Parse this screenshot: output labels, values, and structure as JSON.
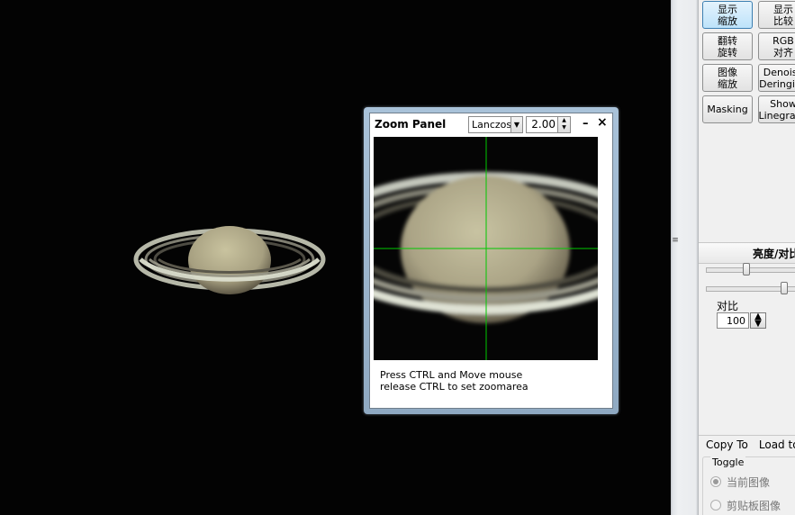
{
  "toolbar": {
    "buttons": [
      {
        "line1": "显示",
        "line2": "缩放",
        "active": true
      },
      {
        "line1": "显示",
        "line2": "比较",
        "active": false
      },
      {
        "line1": "翻转",
        "line2": "旋转",
        "active": false
      },
      {
        "line1": "RGB",
        "line2": "对齐",
        "active": false
      },
      {
        "line1": "图像",
        "line2": "缩放",
        "active": false
      },
      {
        "line1": "Denoise",
        "line2": "Deringing",
        "active": false
      },
      {
        "line1": "Masking",
        "line2": "",
        "active": false
      },
      {
        "line1": "Show",
        "line2": "Linegraph",
        "active": false
      }
    ]
  },
  "brightness": {
    "header": "亮度/对比",
    "brightness_level": 0.43,
    "contrast_level": 0.87,
    "contrast_label": "对比",
    "contrast_value": "100"
  },
  "tabs": {
    "copy_to": "Copy To",
    "load_to": "Load to"
  },
  "toggle": {
    "title": "Toggle",
    "option1": "当前图像",
    "option2": "剪贴板图像",
    "selected": 0
  },
  "zoom_panel": {
    "title": "Zoom Panel",
    "interpolation": "Lanczos",
    "factor": "2.00",
    "minimize_glyph": "–",
    "close_glyph": "×",
    "help_line1": "Press CTRL and Move mouse",
    "help_line2": "release CTRL to set zoomarea",
    "crosshair_color": "#00c800"
  },
  "icons": {
    "separator_grip": "grip-icon",
    "spin": "spin-arrows-icon",
    "dropdown": "chevron-down-icon"
  }
}
